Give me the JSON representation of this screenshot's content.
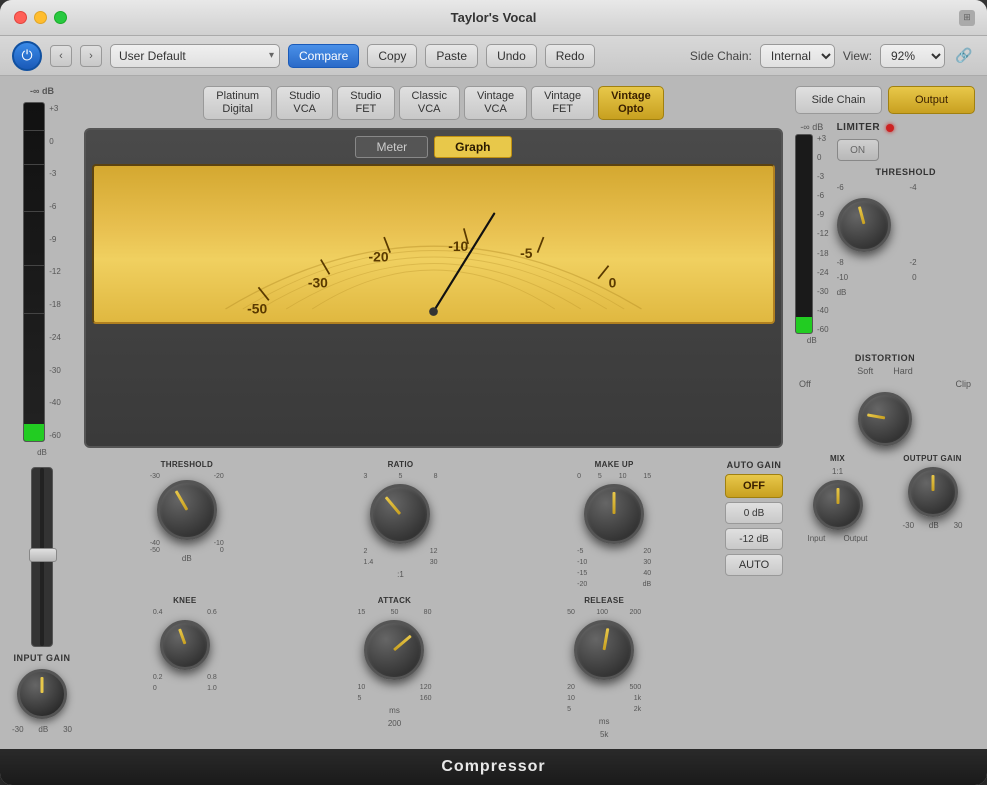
{
  "window": {
    "title": "Taylor's Vocal",
    "bottom_label": "Compressor"
  },
  "toolbar": {
    "preset_value": "User Default",
    "compare_label": "Compare",
    "copy_label": "Copy",
    "paste_label": "Paste",
    "undo_label": "Undo",
    "redo_label": "Redo",
    "side_chain_label": "Side Chain:",
    "side_chain_value": "Internal",
    "view_label": "View:",
    "view_value": "92%"
  },
  "models": [
    {
      "id": "platinum-digital",
      "label": "Platinum\nDigital",
      "active": false
    },
    {
      "id": "studio-vca",
      "label": "Studio\nVCA",
      "active": false
    },
    {
      "id": "studio-fet",
      "label": "Studio\nFET",
      "active": false
    },
    {
      "id": "classic-vca",
      "label": "Classic\nVCA",
      "active": false
    },
    {
      "id": "vintage-vca",
      "label": "Vintage\nVCA",
      "active": false
    },
    {
      "id": "vintage-fet",
      "label": "Vintage\nFET",
      "active": false
    },
    {
      "id": "vintage-opto",
      "label": "Vintage\nOpto",
      "active": true
    }
  ],
  "vu": {
    "meter_tab": "Meter",
    "graph_tab": "Graph",
    "scale_labels": [
      "-50",
      "-30",
      "-20",
      "-10",
      "-5",
      "0"
    ],
    "active_tab": "graph"
  },
  "input_gain": {
    "label": "INPUT GAIN",
    "db_label": "dB",
    "min": "-30",
    "max": "30",
    "inf_label": "-∞ dB"
  },
  "controls": {
    "threshold": {
      "label": "THRESHOLD",
      "min": "-50",
      "max": "0",
      "db": "dB",
      "markers": [
        "-30",
        "-20",
        "-40",
        "-10",
        "-50",
        "0"
      ]
    },
    "ratio": {
      "label": "RATIO",
      "markers": [
        "3",
        "5",
        "8",
        "2",
        "12",
        "1.4",
        ":1",
        "30"
      ]
    },
    "makeup": {
      "label": "MAKE UP",
      "markers": [
        "0",
        "5",
        "10",
        "15",
        "-5",
        "20",
        "-10",
        "30",
        "-15",
        "40",
        "-20",
        "dB"
      ]
    },
    "auto_gain": {
      "title": "AUTO GAIN",
      "off_label": "OFF",
      "db0_label": "0 dB",
      "db12_label": "-12 dB",
      "auto_label": "AUTO"
    },
    "knee": {
      "label": "KNEE",
      "markers": [
        "0.4",
        "0.6",
        "0.2",
        "0.8",
        "0",
        "1.0"
      ]
    },
    "attack": {
      "label": "ATTACK",
      "markers": [
        "15",
        "50",
        "80",
        "10",
        "120",
        "5",
        "160",
        "ms",
        "200"
      ]
    },
    "release": {
      "label": "RELEASE",
      "markers": [
        "50",
        "100",
        "200",
        "20",
        "500",
        "10",
        "1k",
        "5",
        "2k",
        "ms",
        "5k"
      ]
    }
  },
  "right_panel": {
    "side_chain_btn": "Side Chain",
    "output_btn": "Output",
    "limiter_label": "LIMITER",
    "on_label": "ON",
    "threshold_label": "THRESHOLD",
    "threshold_markers": [
      "-6",
      "-4",
      "-8",
      "-2",
      "-10",
      "0",
      "dB"
    ],
    "inf_label": "-∞ dB",
    "distortion_label": "DISTORTION",
    "soft_label": "Soft",
    "hard_label": "Hard",
    "dist_scale": [
      "Off",
      "Clip"
    ],
    "mix_label": "MIX",
    "mix_markers": [
      "1:1",
      "Input",
      "Output"
    ],
    "output_gain_label": "OUTPUT GAIN",
    "output_gain_markers": [
      "-30",
      "dB",
      "30"
    ]
  }
}
